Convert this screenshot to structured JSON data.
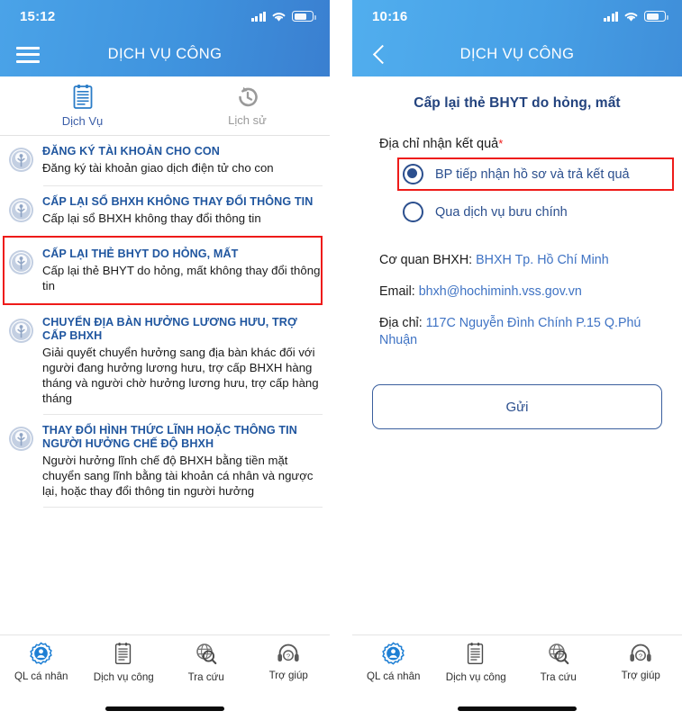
{
  "colors": {
    "header_blue": "#3f93de",
    "title_blue": "#20569f",
    "link_blue": "#3f73c4",
    "radio_blue": "#2b4f8e",
    "highlight_red": "#ee1b19"
  },
  "left_screen": {
    "status": {
      "time": "15:12",
      "signal_icon": "signal-bars-icon",
      "wifi_icon": "wifi-icon",
      "battery_icon": "battery-icon"
    },
    "navbar": {
      "menu_icon": "hamburger-menu-icon",
      "title": "DỊCH VỤ CÔNG"
    },
    "tabs": [
      {
        "label": "Dịch Vụ",
        "icon": "document-list-icon",
        "active": true
      },
      {
        "label": "Lịch sử",
        "icon": "history-clock-icon",
        "active": false
      }
    ],
    "services": [
      {
        "icon": "bhxh-logo-icon",
        "title": "ĐĂNG KÝ TÀI KHOẢN CHO CON",
        "description": "Đăng ký tài khoản giao dịch điện tử cho con",
        "highlighted": false
      },
      {
        "icon": "bhxh-logo-icon",
        "title": "CẤP LẠI SỔ BHXH KHÔNG THAY ĐỔI THÔNG TIN",
        "description": "Cấp lại sổ BHXH không thay đổi thông tin",
        "highlighted": false
      },
      {
        "icon": "bhxh-logo-icon",
        "title": "CẤP LẠI THẺ BHYT DO HỎNG, MẤT",
        "description": "Cấp lại thẻ BHYT do hỏng, mất không thay đổi thông tin",
        "highlighted": true
      },
      {
        "icon": "bhxh-logo-icon",
        "title": "CHUYỂN ĐỊA BÀN HƯỞNG LƯƠNG HƯU, TRỢ CẤP BHXH",
        "description": "Giải quyết chuyển hưởng sang địa bàn khác đối với người đang hưởng lương hưu, trợ cấp BHXH hàng tháng và người chờ hưởng lương hưu, trợ cấp hàng tháng",
        "highlighted": false
      },
      {
        "icon": "bhxh-logo-icon",
        "title": "THAY ĐỔI HÌNH THỨC LĨNH HOẶC THÔNG TIN NGƯỜI HƯỞNG CHẾ ĐỘ BHXH",
        "description": "Người hưởng lĩnh chế độ BHXH bằng tiền mặt chuyển sang lĩnh bằng tài khoản cá nhân và ngược lại, hoặc thay đổi thông tin người hưởng",
        "highlighted": false
      }
    ]
  },
  "right_screen": {
    "status": {
      "time": "10:16",
      "signal_icon": "signal-bars-icon",
      "wifi_icon": "wifi-icon",
      "battery_icon": "battery-icon"
    },
    "navbar": {
      "back_icon": "chevron-left-icon",
      "title": "DỊCH VỤ CÔNG"
    },
    "page_title": "Cấp lại thẻ BHYT do hỏng, mất",
    "form": {
      "address_label": "Địa chỉ nhận kết quả",
      "required_marker": "*",
      "options": [
        {
          "label": "BP tiếp nhận hồ sơ và trả kết quả",
          "selected": true,
          "highlighted": true
        },
        {
          "label": "Qua dịch vụ bưu chính",
          "selected": false,
          "highlighted": false
        }
      ],
      "info": [
        {
          "label": "Cơ quan BHXH:",
          "value": "BHXH Tp. Hồ Chí Minh"
        },
        {
          "label": "Email:",
          "value": "bhxh@hochiminh.vss.gov.vn"
        },
        {
          "label": "Địa chỉ:",
          "value": "117C Nguyễn Đình Chính P.15 Q.Phú Nhuận"
        }
      ],
      "submit_label": "Gửi"
    }
  },
  "bottom_nav": [
    {
      "label": "QL cá nhân",
      "icon": "personal-management-icon",
      "active": true
    },
    {
      "label": "Dịch vụ công",
      "icon": "public-service-document-icon",
      "active": false
    },
    {
      "label": "Tra cứu",
      "icon": "globe-search-icon",
      "active": false
    },
    {
      "label": "Trợ giúp",
      "icon": "headset-help-icon",
      "active": false
    }
  ]
}
